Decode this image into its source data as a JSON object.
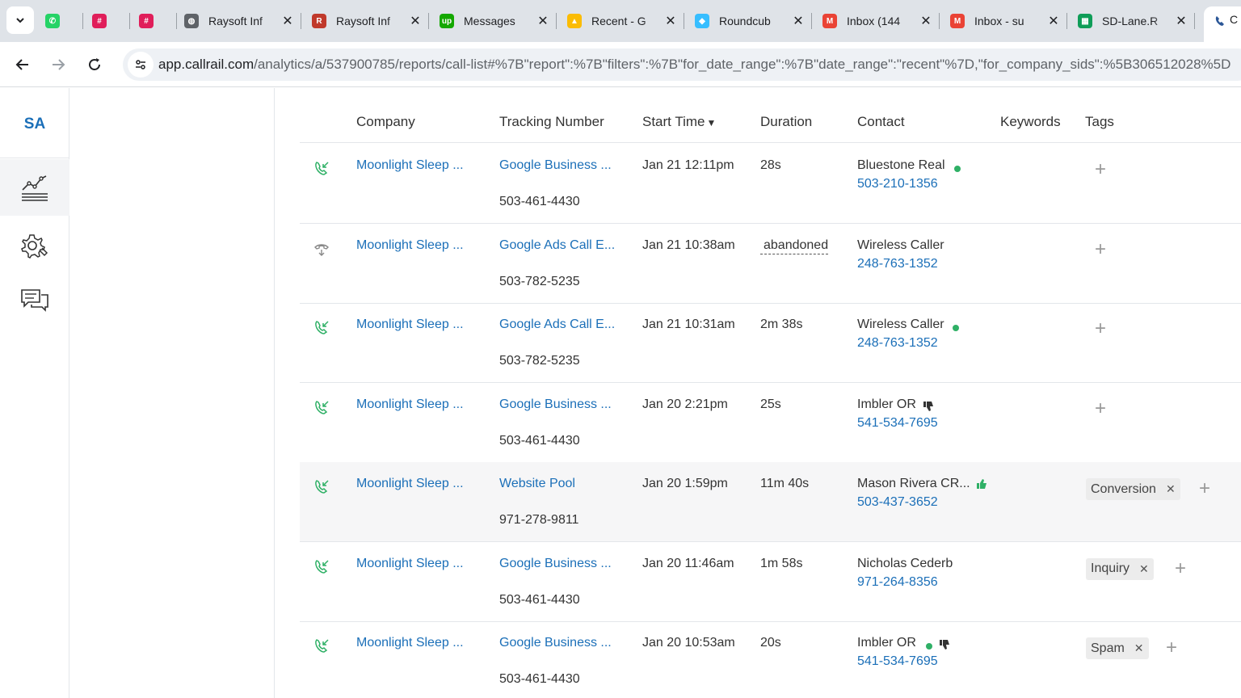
{
  "browser": {
    "tabs": [
      {
        "title": "",
        "icon": "whatsapp-icon",
        "color": "#25d366"
      },
      {
        "title": "",
        "icon": "slack-icon",
        "color": "#e01e5a"
      },
      {
        "title": "",
        "icon": "slack-icon",
        "color": "#e01e5a"
      },
      {
        "title": "Raysoft Inf",
        "icon": "globe-icon",
        "color": "#5f6368"
      },
      {
        "title": "Raysoft Inf",
        "icon": "raysoft-icon",
        "color": "#c0392b"
      },
      {
        "title": "Messages",
        "icon": "upwork-icon",
        "color": "#14a800"
      },
      {
        "title": "Recent - G",
        "icon": "drive-icon",
        "color": "#fbbc04"
      },
      {
        "title": "Roundcub",
        "icon": "roundcube-icon",
        "color": "#37beff"
      },
      {
        "title": "Inbox (144",
        "icon": "gmail-icon",
        "color": "#ea4335"
      },
      {
        "title": "Inbox - su",
        "icon": "gmail-icon",
        "color": "#ea4335"
      },
      {
        "title": "SD-Lane.R",
        "icon": "sheets-icon",
        "color": "#0f9d58"
      }
    ],
    "active_tab_partial": "C",
    "url_host": "app.callrail.com",
    "url_path": "/analytics/a/537900785/reports/call-list#%7B\"report\":%7B\"filters\":%7B\"for_date_range\":%7B\"date_range\":\"recent\"%7D,\"for_company_sids\":%5B306512028%5D"
  },
  "leftnav": {
    "initials": "SA",
    "items": [
      {
        "icon": "analytics-chart-icon"
      },
      {
        "icon": "settings-gear-icon"
      },
      {
        "icon": "chat-bubbles-icon"
      }
    ]
  },
  "table": {
    "headers": {
      "company": "Company",
      "tracking": "Tracking Number",
      "start": "Start Time",
      "duration": "Duration",
      "contact": "Contact",
      "keywords": "Keywords",
      "tags": "Tags"
    },
    "rows": [
      {
        "status": "answered",
        "company": "Moonlight Sleep ...",
        "tracking": "Google Business ...",
        "tracking_number": "503-461-4430",
        "start": "Jan 21 12:11pm",
        "duration": "28s",
        "contact": "Bluestone Real",
        "phone": "503-210-1356",
        "dot": true,
        "rating": "",
        "tags": []
      },
      {
        "status": "abandoned",
        "company": "Moonlight Sleep ...",
        "tracking": "Google Ads Call E...",
        "tracking_number": "503-782-5235",
        "start": "Jan 21 10:38am",
        "duration": "abandoned",
        "contact": "Wireless Caller",
        "phone": "248-763-1352",
        "dot": false,
        "rating": "",
        "tags": []
      },
      {
        "status": "answered",
        "company": "Moonlight Sleep ...",
        "tracking": "Google Ads Call E...",
        "tracking_number": "503-782-5235",
        "start": "Jan 21 10:31am",
        "duration": "2m 38s",
        "contact": "Wireless Caller",
        "phone": "248-763-1352",
        "dot": true,
        "rating": "",
        "tags": []
      },
      {
        "status": "answered",
        "company": "Moonlight Sleep ...",
        "tracking": "Google Business ...",
        "tracking_number": "503-461-4430",
        "start": "Jan 20 2:21pm",
        "duration": "25s",
        "contact": "Imbler OR",
        "phone": "541-534-7695",
        "dot": false,
        "rating": "thumbs-down",
        "tags": []
      },
      {
        "status": "answered",
        "company": "Moonlight Sleep ...",
        "tracking": "Website Pool",
        "tracking_number": "971-278-9811",
        "start": "Jan 20 1:59pm",
        "duration": "11m 40s",
        "contact": "Mason Rivera CR...",
        "phone": "503-437-3652",
        "dot": false,
        "rating": "thumbs-up",
        "tags": [
          "Conversion"
        ]
      },
      {
        "status": "answered",
        "company": "Moonlight Sleep ...",
        "tracking": "Google Business ...",
        "tracking_number": "503-461-4430",
        "start": "Jan 20 11:46am",
        "duration": "1m 58s",
        "contact": "Nicholas Cederb",
        "phone": "971-264-8356",
        "dot": false,
        "rating": "",
        "tags": [
          "Inquiry"
        ]
      },
      {
        "status": "answered",
        "company": "Moonlight Sleep ...",
        "tracking": "Google Business ...",
        "tracking_number": "503-461-4430",
        "start": "Jan 20 10:53am",
        "duration": "20s",
        "contact": "Imbler OR",
        "phone": "541-534-7695",
        "dot": true,
        "rating": "thumbs-down",
        "tags": [
          "Spam"
        ]
      }
    ]
  },
  "colors": {
    "link": "#1b6fb8",
    "answered_icon": "#2fb066",
    "dot": "#2fb066"
  }
}
